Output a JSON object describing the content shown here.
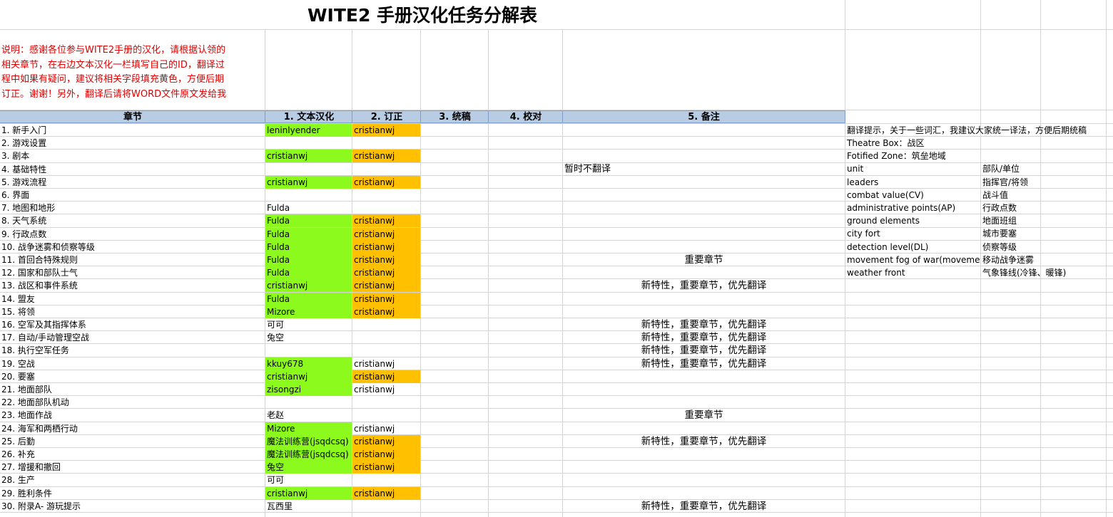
{
  "title": "WITE2 手册汉化任务分解表",
  "note": "说明：感谢各位参与WITE2手册的汉化，请根据认领的\n相关章节，在右边文本汉化一栏填写自己的ID，翻译过\n程中如果有疑问，建议将相关字段填充黄色，方便后期\n订正。谢谢！另外，翻译后请将WORD文件原文发给我",
  "headers": [
    "章节",
    "1. 文本汉化",
    "2. 订正",
    "3. 统稿",
    "4. 校对",
    "5. 备注"
  ],
  "colors": {
    "green": "#8cfa1c",
    "orange": "#ffc000",
    "header": "#b8cce4",
    "note": "#e00000"
  },
  "rows": [
    {
      "chapter": "1. 新手入门",
      "translate": "leninlyender",
      "tg": true,
      "review": "cristianwj",
      "ro": true,
      "remark": ""
    },
    {
      "chapter": "2. 游戏设置",
      "translate": "",
      "tg": false,
      "review": "",
      "ro": false,
      "remark": ""
    },
    {
      "chapter": "3. 剧本",
      "translate": "cristianwj",
      "tg": true,
      "review": "cristianwj",
      "ro": true,
      "remark": ""
    },
    {
      "chapter": "4. 基础特性",
      "translate": "",
      "tg": false,
      "review": "",
      "ro": false,
      "remark": "暂时不翻译",
      "left": true
    },
    {
      "chapter": "5. 游戏流程",
      "translate": "cristianwj",
      "tg": true,
      "review": "cristianwj",
      "ro": true,
      "remark": ""
    },
    {
      "chapter": "6. 界面",
      "translate": "",
      "tg": false,
      "review": "",
      "ro": false,
      "remark": ""
    },
    {
      "chapter": "7. 地图和地形",
      "translate": "Fulda",
      "tg": false,
      "review": "",
      "ro": false,
      "remark": ""
    },
    {
      "chapter": "8. 天气系统",
      "translate": "Fulda",
      "tg": true,
      "review": "cristianwj",
      "ro": true,
      "remark": ""
    },
    {
      "chapter": "9. 行政点数",
      "translate": "Fulda",
      "tg": true,
      "review": "cristianwj",
      "ro": true,
      "remark": ""
    },
    {
      "chapter": "10. 战争迷雾和侦察等级",
      "translate": "Fulda",
      "tg": true,
      "review": "cristianwj",
      "ro": true,
      "remark": ""
    },
    {
      "chapter": "11. 首回合特殊规则",
      "translate": "Fulda",
      "tg": true,
      "review": "cristianwj",
      "ro": true,
      "remark": "重要章节"
    },
    {
      "chapter": "12. 国家和部队士气",
      "translate": "Fulda",
      "tg": true,
      "review": "cristianwj",
      "ro": true,
      "remark": ""
    },
    {
      "chapter": "13. 战区和事件系统",
      "translate": "cristianwj",
      "tg": true,
      "review": "cristianwj",
      "ro": true,
      "remark": "新特性，重要章节，优先翻译"
    },
    {
      "chapter": "14. 盟友",
      "translate": "Fulda",
      "tg": true,
      "review": "cristianwj",
      "ro": true,
      "remark": ""
    },
    {
      "chapter": "15. 将领",
      "translate": "Mizore",
      "tg": true,
      "review": "cristianwj",
      "ro": true,
      "remark": ""
    },
    {
      "chapter": "16. 空军及其指挥体系",
      "translate": "可可",
      "tg": false,
      "review": "",
      "ro": false,
      "remark": "新特性，重要章节，优先翻译"
    },
    {
      "chapter": "17. 自动/手动管理空战",
      "translate": "兔空",
      "tg": false,
      "review": "",
      "ro": false,
      "remark": "新特性，重要章节，优先翻译"
    },
    {
      "chapter": "18. 执行空军任务",
      "translate": "",
      "tg": false,
      "review": "",
      "ro": false,
      "remark": "新特性，重要章节，优先翻译"
    },
    {
      "chapter": "19. 空战",
      "translate": "kkuy678",
      "tg": true,
      "review": "cristianwj",
      "ro": false,
      "remark": "新特性，重要章节，优先翻译"
    },
    {
      "chapter": "20. 要塞",
      "translate": "cristianwj",
      "tg": true,
      "review": "cristianwj",
      "ro": true,
      "remark": ""
    },
    {
      "chapter": "21. 地面部队",
      "translate": "zisongzi",
      "tg": true,
      "review": "cristianwj",
      "ro": false,
      "remark": ""
    },
    {
      "chapter": "22. 地面部队机动",
      "translate": "",
      "tg": false,
      "review": "",
      "ro": false,
      "remark": ""
    },
    {
      "chapter": "23. 地面作战",
      "translate": "老赵",
      "tg": false,
      "review": "",
      "ro": false,
      "remark": "重要章节"
    },
    {
      "chapter": "24. 海军和两栖行动",
      "translate": "Mizore",
      "tg": true,
      "review": "cristianwj",
      "ro": false,
      "remark": ""
    },
    {
      "chapter": "25. 后勤",
      "translate": "魔法训练营(jsqdcsq)",
      "tg": true,
      "review": "cristianwj",
      "ro": true,
      "remark": "新特性，重要章节，优先翻译"
    },
    {
      "chapter": "26. 补充",
      "translate": "魔法训练营(jsqdcsq)",
      "tg": true,
      "review": "cristianwj",
      "ro": true,
      "remark": ""
    },
    {
      "chapter": "27. 增援和撤回",
      "translate": "兔空",
      "tg": true,
      "review": "cristianwj",
      "ro": true,
      "remark": ""
    },
    {
      "chapter": "28. 生产",
      "translate": "可可",
      "tg": false,
      "review": "",
      "ro": false,
      "remark": ""
    },
    {
      "chapter": "29. 胜利条件",
      "translate": "cristianwj",
      "tg": true,
      "review": "cristianwj",
      "ro": true,
      "remark": ""
    },
    {
      "chapter": "30. 附录A- 游玩提示",
      "translate": "瓦西里",
      "tg": false,
      "review": "",
      "ro": false,
      "remark": "新特性，重要章节，优先翻译"
    }
  ],
  "glossary_tip": "翻译提示，关于一些词汇，我建议大家统一译法，方便后期统稿",
  "glossary": [
    {
      "en": "Theatre Box：战区",
      "zh": ""
    },
    {
      "en": "Fotified Zone：筑垒地域",
      "zh": ""
    },
    {
      "en": "unit",
      "zh": "部队/单位"
    },
    {
      "en": "leaders",
      "zh": "指挥官/将领"
    },
    {
      "en": "combat value(CV)",
      "zh": "战斗值"
    },
    {
      "en": "administrative points(AP)",
      "zh": "行政点数"
    },
    {
      "en": "ground elements",
      "zh": "地面班组"
    },
    {
      "en": "city fort",
      "zh": "城市要塞"
    },
    {
      "en": "detection level(DL)",
      "zh": "侦察等级"
    },
    {
      "en": "movement fog of war(movement l",
      "zh": "移动战争迷雾"
    },
    {
      "en": "weather front",
      "zh": "气象锋线(冷锋、暖锋)"
    }
  ]
}
